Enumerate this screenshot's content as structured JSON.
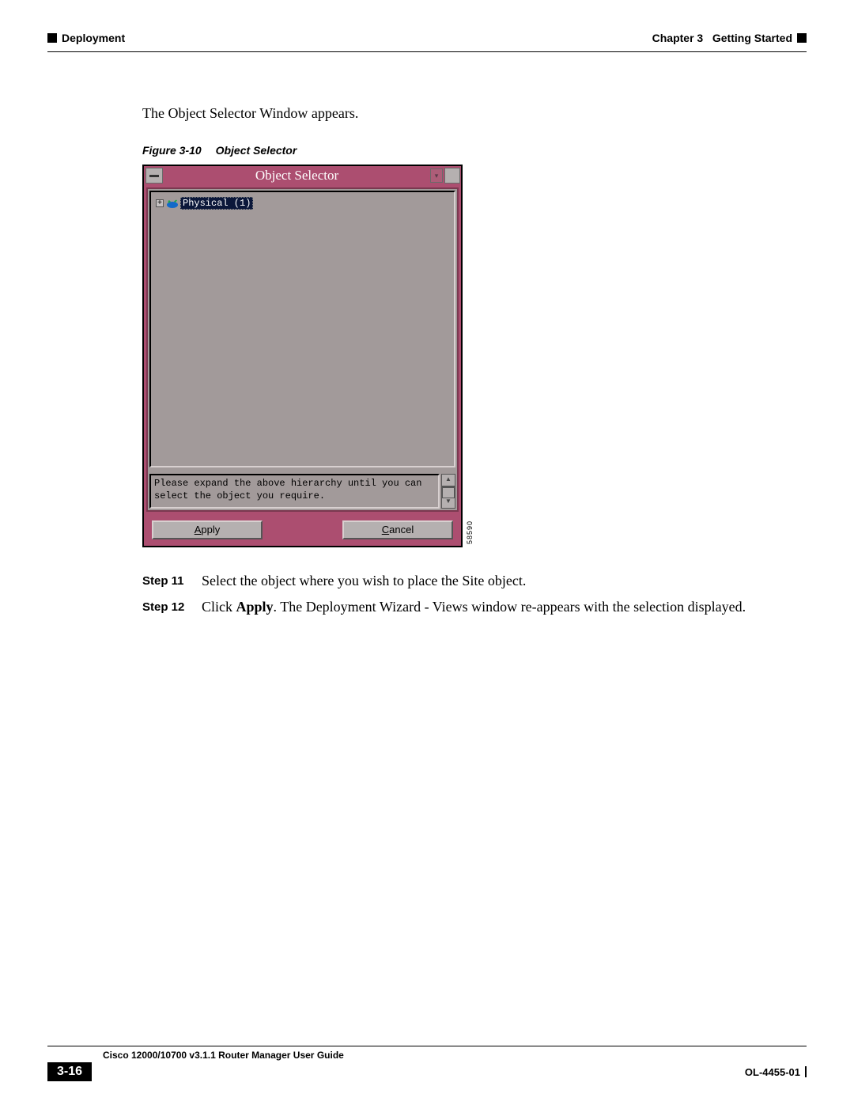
{
  "header": {
    "section": "Deployment",
    "chapter_label": "Chapter 3",
    "chapter_title": "Getting Started"
  },
  "intro_text": "The Object Selector Window appears.",
  "figure": {
    "number": "Figure 3-10",
    "title": "Object Selector",
    "image_id": "58590"
  },
  "object_selector": {
    "title": "Object Selector",
    "tree": {
      "root_label": "Physical (1)"
    },
    "message": "Please expand the above hierarchy until you can select the object you require.",
    "buttons": {
      "apply": "Apply",
      "cancel": "Cancel"
    }
  },
  "steps": [
    {
      "label": "Step 11",
      "text": "Select the object where you wish to place the Site object."
    },
    {
      "label": "Step 12",
      "text_prefix": "Click ",
      "bold": "Apply",
      "text_suffix": ". The Deployment Wizard - Views window re-appears with the selection displayed."
    }
  ],
  "footer": {
    "guide": "Cisco 12000/10700 v3.1.1 Router Manager User Guide",
    "page": "3-16",
    "docid": "OL-4455-01"
  }
}
